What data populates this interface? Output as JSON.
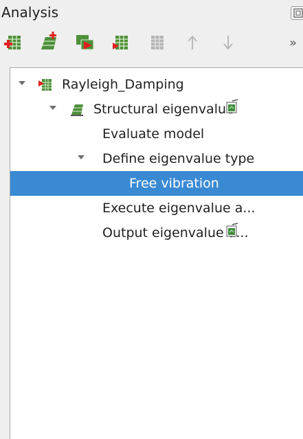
{
  "panel": {
    "title": "Analysis"
  },
  "toolbar": {
    "buttons": [
      {
        "name": "add-analysis-icon"
      },
      {
        "name": "add-command-icon"
      },
      {
        "name": "run-analysis-icon"
      },
      {
        "name": "run-command-icon"
      },
      {
        "name": "disabled-command-icon"
      },
      {
        "name": "move-up-icon"
      },
      {
        "name": "move-down-icon"
      }
    ],
    "more": "»"
  },
  "tree": {
    "items": [
      {
        "label": "Rayleigh_Damping",
        "level": 0,
        "expanded": true,
        "selected": false
      },
      {
        "label": "Structural eigenvalue",
        "level": 1,
        "expanded": true,
        "selected": false
      },
      {
        "label": "Evaluate model",
        "level": 2,
        "selected": false
      },
      {
        "label": "Define eigenvalue type",
        "level": 2,
        "expanded": true,
        "selected": false
      },
      {
        "label": "Free vibration",
        "level": 3,
        "selected": true
      },
      {
        "label": "Execute eigenvalue a...",
        "level": 2,
        "selected": false
      },
      {
        "label": "Output eigenvalue a...",
        "level": 2,
        "selected": false
      }
    ]
  },
  "colors": {
    "selection": "#3a89d3",
    "panel_bg": "#efefef",
    "tree_bg": "#ffffff"
  }
}
